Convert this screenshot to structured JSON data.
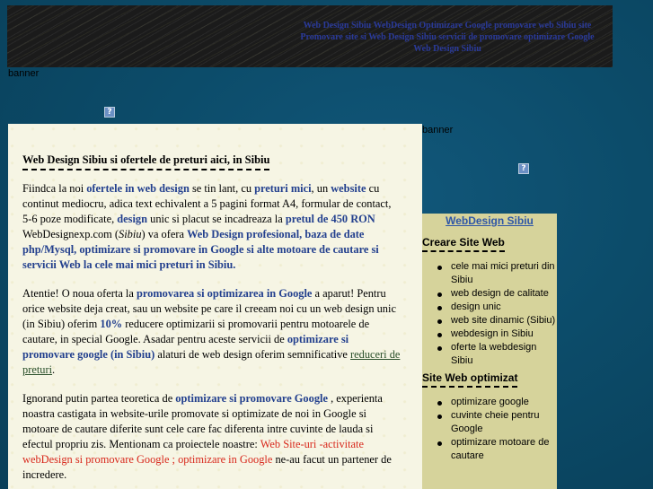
{
  "header": {
    "links": [
      "Web Design Sibiu",
      "WebDesign Optimizare Google promovare web Sibiu site",
      "Promovare site si Web Design Sibiu servicii de promovare optimizare Google",
      "Web Design Sibiu"
    ]
  },
  "banner_labels": [
    "banner",
    "banner"
  ],
  "main": {
    "title": "Web Design Sibiu si ofertele de preturi aici, in Sibiu",
    "p1": {
      "t1": " Fiindca la noi ",
      "b1": "ofertele in web design",
      "t2": " se tin lant, cu ",
      "b2": "preturi mici",
      "t3": ", un ",
      "b3": "website",
      "t4": " cu continut mediocru, adica text echivalent a 5 pagini format A4, formular de contact, 5-6 poze modificate, ",
      "b4": "design",
      "t5": " unic si placut se incadreaza la ",
      "b5": "pretul de 450 RON",
      "t6": " WebDesignexp.com (",
      "i1": "Sibiu",
      "t7": ") va ofera ",
      "b6": "Web Design profesional, baza de date php/Mysql, optimizare si promovare in Google si alte motoare de cautare si servicii Web la cele mai mici preturi in Sibiu."
    },
    "p2": {
      "t1": " Atentie! O noua oferta la ",
      "b1": "promovarea si optimizarea in Google",
      "t2": " a aparut! Pentru orice website deja creat, sau un website pe care il creeam noi cu un web design unic (in Sibiu) oferim ",
      "b2": "10%",
      "t3": " reducere optimizarii si promovarii pentru motoarele de cautare, in special Google. Asadar pentru aceste servicii de ",
      "b3": "optimizare si promovare google (in Sibiu)",
      "t4": " alaturi de web design oferim semnificative ",
      "u1": "reduceri de preturi",
      "t5": "."
    },
    "p3": {
      "t1": " Ignorand putin partea teoretica de ",
      "b1": "optimizare si promovare Google",
      "t2": " , experienta noastra castigata in website-urile promovate si optimizate de noi in Google si motoare de cautare diferite sunt cele care fac diferenta intre cuvinte de lauda si efectul propriu zis.   Mentionam ca proiectele noastre: ",
      "r1": "Web Site-uri -activitate webDesign si promovare Google ; optimizare in Google",
      "t3": " ne-au facut un partener de incredere."
    }
  },
  "sidebar": {
    "title": "WebDesign Sibiu",
    "sections": [
      {
        "heading": "Creare Site Web",
        "items": [
          "cele mai mici preturi din Sibiu",
          "web design de calitate",
          "design unic",
          "web site dinamic (Sibiu)",
          "webdesign in Sibiu",
          "oferte la webdesign Sibiu"
        ]
      },
      {
        "heading": "Site Web optimizat",
        "items": [
          "optimizare google",
          "cuvinte cheie pentru Google",
          "optimizare motoare de cautare"
        ]
      }
    ]
  },
  "icons": {
    "broken_image": "broken-image-icon"
  },
  "colors": {
    "link_blue": "#23408e",
    "link_red": "#d8281c",
    "sidebar_bg": "#d6d39b",
    "content_bg": "#f6f5e4"
  }
}
